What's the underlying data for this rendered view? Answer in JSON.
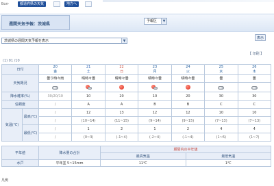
{
  "topnav": {
    "link1": "Бол·",
    "link2": "地方名",
    "tab1": "都道府県の天気",
    "tab2": "地方へ"
  },
  "header": {
    "title": "週間天気予報：茨城県",
    "region_select": "予報区",
    "go_button": "表示"
  },
  "area_select": "茨城県の週間天気予報を表示",
  "links": {
    "right": "【 印刷 】",
    "left": "(1)  01  /10"
  },
  "forecast": {
    "row_labels": {
      "date": "日付",
      "weather": "天気概況",
      "pop": "降水確率(%)",
      "reliability": "信頼度",
      "temp_group": "気温(℃)",
      "temp_max": "最高(℃)",
      "temp_min": "最低(℃)"
    },
    "days": [
      {
        "date": "20",
        "wd": "金"
      },
      {
        "date": "21",
        "wd": "土"
      },
      {
        "date": "22",
        "wd": "日"
      },
      {
        "date": "23",
        "wd": "月"
      },
      {
        "date": "24",
        "wd": "火"
      },
      {
        "date": "25",
        "wd": "水"
      },
      {
        "date": "26",
        "wd": "木"
      }
    ],
    "summary": [
      "曇り時々雨",
      "晴時々曇",
      "晴時々曇",
      "晴時々曇",
      "晴時々曇",
      "曇",
      "曇"
    ],
    "icons": [
      "cloud-icon",
      "mix-icon",
      "sun-icon",
      "mix-icon",
      "sun-icon",
      "cloud-icon",
      "cloud-icon"
    ],
    "pop": [
      "30/20/10",
      "10",
      "20",
      "10",
      "20",
      "30",
      "30"
    ],
    "reliability": [
      "/",
      "A",
      "A",
      "B",
      "B",
      "C",
      "C"
    ],
    "max": [
      "/",
      "12",
      "13",
      "12",
      "12",
      "10",
      "10"
    ],
    "max_range": [
      "/",
      "(10~14)",
      "(11~15)",
      "(9~14)",
      "(9~15)",
      "(7~13)",
      "(7~13)"
    ],
    "min": [
      "/",
      "1",
      "2",
      "1",
      "2",
      "4",
      "4"
    ],
    "min_range": [
      "/",
      "(0~3)",
      "(-1~4)",
      "(-2~4)",
      "(-1~4)",
      "(1~6)",
      "(1~7)"
    ]
  },
  "bottom": {
    "label1": "平年値",
    "label2": "降水量の合計",
    "label3": "期間内の平年値",
    "row2_label": "水戸",
    "col_a": "最高気温",
    "col_b": "最低気温",
    "v1": "平年並 5~15mm",
    "v2": "11℃",
    "v3": "1℃"
  },
  "footer": "凡例"
}
